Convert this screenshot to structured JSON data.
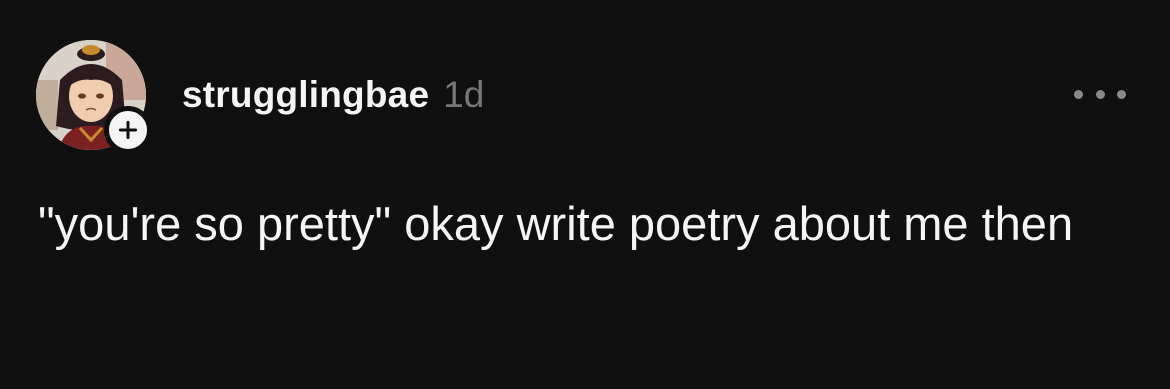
{
  "post": {
    "username": "strugglingbae",
    "timestamp": "1d",
    "text": "\"you're so pretty\" okay write poetry about me then"
  },
  "icons": {
    "avatar": "profile-picture",
    "follow": "plus-icon",
    "more": "more-options-icon"
  },
  "colors": {
    "background": "#101010",
    "text": "#f3f5f7",
    "muted": "#777777"
  }
}
